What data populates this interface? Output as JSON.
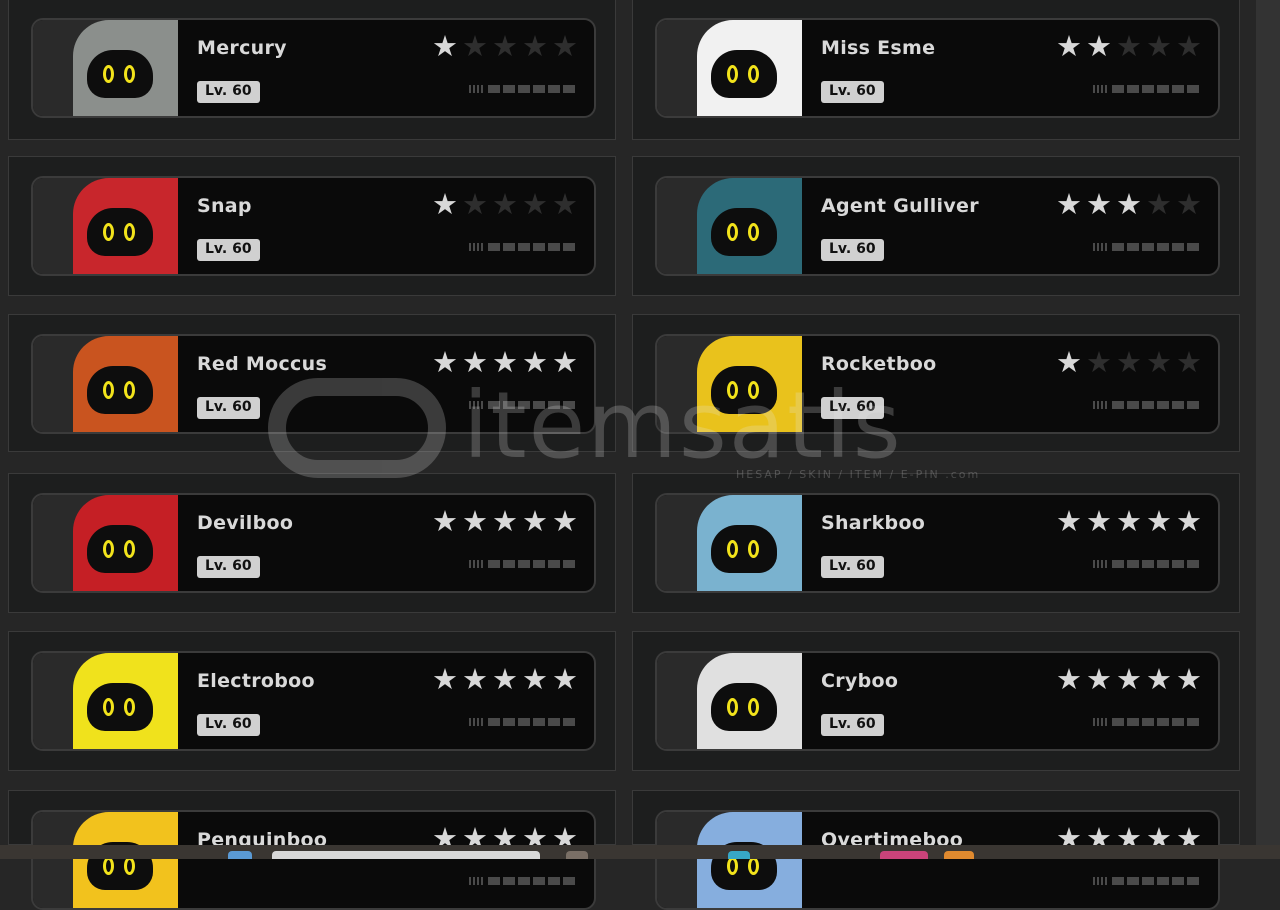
{
  "characters": [
    {
      "name": "Mercury",
      "level": "Lv. 60",
      "stars": 1,
      "color": "#8b8f8c"
    },
    {
      "name": "Miss Esme",
      "level": "Lv. 60",
      "stars": 2,
      "color": "#f1f1f1"
    },
    {
      "name": "Snap",
      "level": "Lv. 60",
      "stars": 1,
      "color": "#c8262c"
    },
    {
      "name": "Agent Gulliver",
      "level": "Lv. 60",
      "stars": 3,
      "color": "#2c6a78"
    },
    {
      "name": "Red Moccus",
      "level": "Lv. 60",
      "stars": 5,
      "color": "#c9541f"
    },
    {
      "name": "Rocketboo",
      "level": "Lv. 60",
      "stars": 1,
      "color": "#e9c21c"
    },
    {
      "name": "Devilboo",
      "level": "Lv. 60",
      "stars": 5,
      "color": "#c51f25"
    },
    {
      "name": "Sharkboo",
      "level": "Lv. 60",
      "stars": 5,
      "color": "#7ab2cf"
    },
    {
      "name": "Electroboo",
      "level": "Lv. 60",
      "stars": 5,
      "color": "#f0e21c"
    },
    {
      "name": "Cryboo",
      "level": "Lv. 60",
      "stars": 5,
      "color": "#e0e0e0"
    },
    {
      "name": "Penguinboo",
      "level": "",
      "stars": 5,
      "color": "#f2c21d"
    },
    {
      "name": "Overtimeboo",
      "level": "",
      "stars": 5,
      "color": "#86aede"
    }
  ],
  "star_glyph": "★",
  "watermark": {
    "word": "itemsatis",
    "sub": "HESAP / SKIN / ITEM / E-PIN .com"
  },
  "taskbar_colors": [
    "#5a9ad5",
    "#d8d8d8",
    "#7a6f66",
    "#37a7c7",
    "#c9437a",
    "#e08a2f"
  ]
}
